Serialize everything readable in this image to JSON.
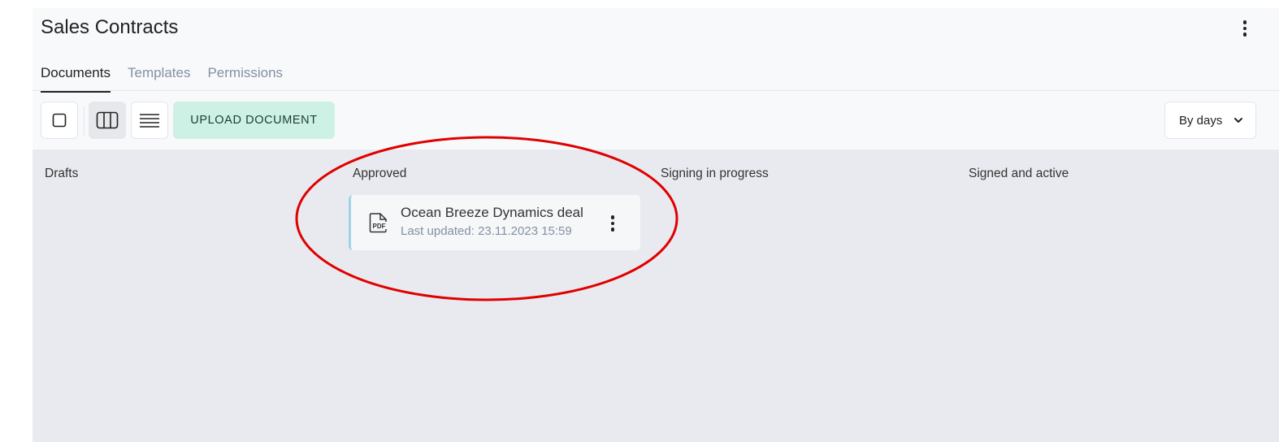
{
  "header": {
    "title": "Sales Contracts",
    "menu_icon": "more-vertical-icon"
  },
  "tabs": [
    {
      "label": "Documents",
      "active": true
    },
    {
      "label": "Templates",
      "active": false
    },
    {
      "label": "Permissions",
      "active": false
    }
  ],
  "toolbar": {
    "view_buttons": [
      {
        "icon": "square-view-icon",
        "selected": false
      },
      {
        "icon": "columns-view-icon",
        "selected": true
      },
      {
        "icon": "list-view-icon",
        "selected": false
      }
    ],
    "upload_label": "UPLOAD DOCUMENT",
    "group_select": {
      "value": "By days",
      "icon": "chevron-down-icon"
    }
  },
  "board": {
    "columns": [
      {
        "title": "Drafts",
        "cards": []
      },
      {
        "title": "Approved",
        "cards": [
          {
            "name": "Ocean Breeze Dynamics deal",
            "updated": "Last updated: 23.11.2023 15:59",
            "icon": "pdf-file-icon"
          }
        ]
      },
      {
        "title": "Signing in progress",
        "cards": []
      },
      {
        "title": "Signed and active",
        "cards": []
      }
    ]
  },
  "colors": {
    "upload_bg": "#cdf1e5",
    "board_bg": "#e9eaef",
    "card_accent": "#9fd3e3",
    "highlight": "#e00000"
  }
}
